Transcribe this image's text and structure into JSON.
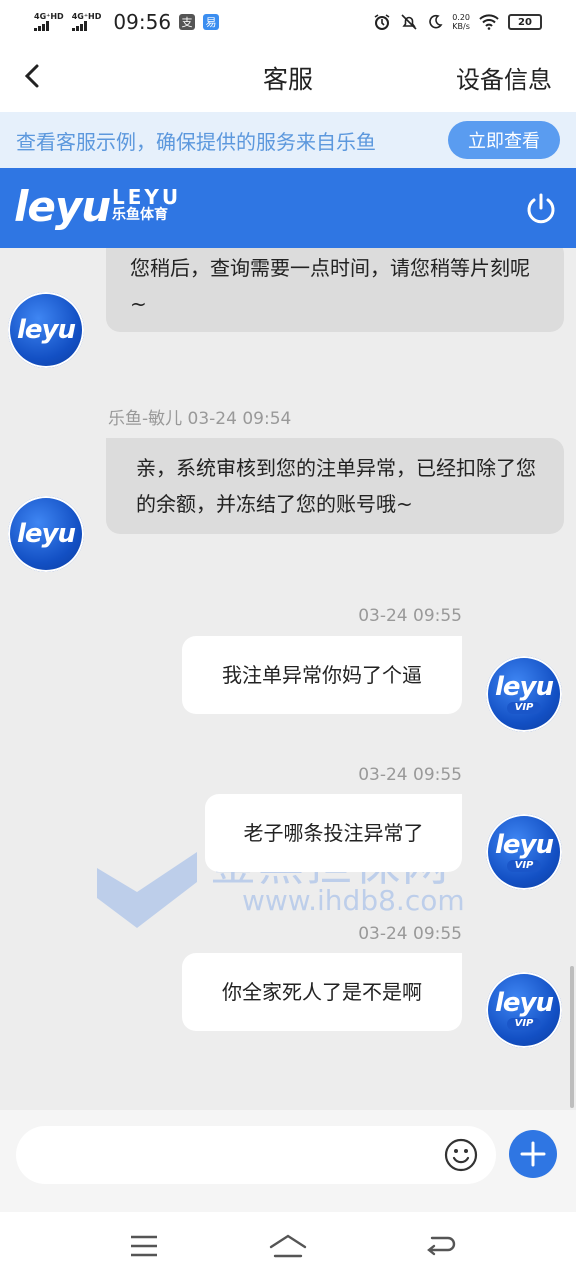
{
  "status_bar": {
    "network1": "4G⁺HD",
    "network2": "4G⁺HD",
    "time": "09:56",
    "speed_value": "0.20",
    "speed_unit": "KB/s",
    "battery": "20"
  },
  "header": {
    "title": "客服",
    "right_action": "设备信息"
  },
  "notice": {
    "text": "查看客服示例，确保提供的服务来自乐鱼",
    "button": "立即查看"
  },
  "brand": {
    "logo": "leyu",
    "en": "LEYU",
    "cn": "乐鱼体育"
  },
  "avatar": {
    "logo": "leyu",
    "vip": "VIP"
  },
  "messages": [
    {
      "side": "left",
      "meta": "",
      "text": "您稍后，查询需要一点时间，请您稍等片刻呢~"
    },
    {
      "side": "left",
      "meta": "乐鱼-敏儿 03-24 09:54",
      "text": "亲，系统审核到您的注单异常，已经扣除了您的余额，并冻结了您的账号哦~"
    },
    {
      "side": "right",
      "meta": "03-24 09:55",
      "text": "我注单异常你妈了个逼"
    },
    {
      "side": "right",
      "meta": "03-24 09:55",
      "text": "老子哪条投注异常了"
    },
    {
      "side": "right",
      "meta": "03-24 09:55",
      "text": "你全家死人了是不是啊"
    }
  ],
  "watermark": {
    "text": "鉴黑担保网",
    "url": "www.ihdb8.com"
  },
  "input": {
    "placeholder": ""
  }
}
